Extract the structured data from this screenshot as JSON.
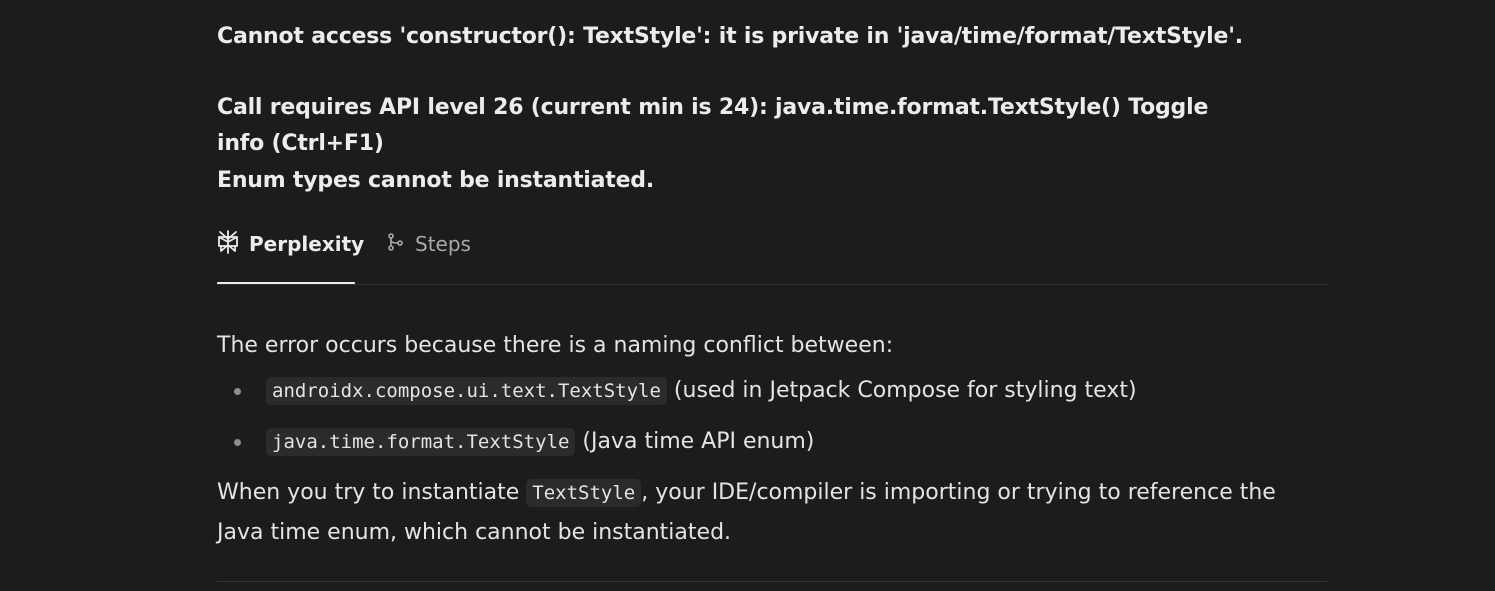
{
  "query": {
    "line1": "Cannot access 'constructor(): TextStyle': it is private in 'java/time/format/TextStyle'.",
    "line2": "Call requires API level 26 (current min is 24): java.time.format.TextStyle() Toggle info (Ctrl+F1)",
    "line3": "Enum types cannot be instantiated."
  },
  "tabs": {
    "perplexity": {
      "label": "Perplexity",
      "icon": "perplexity-logo-icon"
    },
    "steps": {
      "label": "Steps",
      "icon": "steps-branch-icon"
    }
  },
  "answer": {
    "intro": "The error occurs because there is a naming conflict between:",
    "bullets": [
      {
        "code": "androidx.compose.ui.text.TextStyle",
        "text": " (used in Jetpack Compose for styling text)"
      },
      {
        "code": "java.time.format.TextStyle",
        "text": " (Java time API enum)"
      }
    ],
    "para2": {
      "before": "When you try to instantiate ",
      "code": "TextStyle",
      "after": ", your IDE/compiler is importing or trying to reference the Java time enum, which cannot be instantiated."
    }
  },
  "colors": {
    "background": "#1b1c1c",
    "text": "#e8e8e6",
    "muted": "#a9aaa8",
    "code_bg": "#2a2b2b"
  }
}
